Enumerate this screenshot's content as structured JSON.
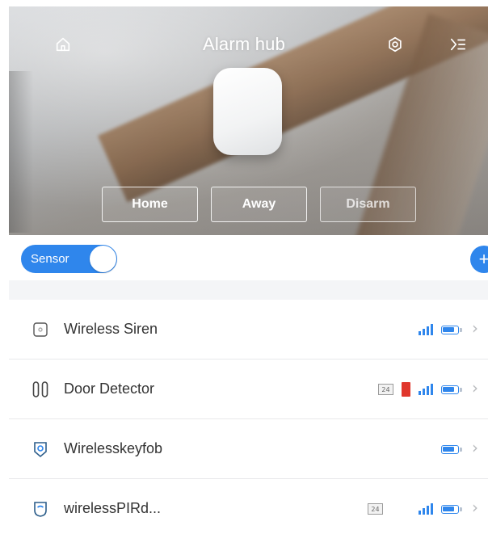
{
  "header": {
    "title": "Alarm hub",
    "home_icon": "home-icon",
    "settings_icon": "settings-icon",
    "menu_icon": "menu-icon"
  },
  "modes": [
    {
      "label": "Home",
      "dimmed": false
    },
    {
      "label": "Away",
      "dimmed": false
    },
    {
      "label": "Disarm",
      "dimmed": true
    }
  ],
  "sensor_toggle": {
    "label": "Sensor",
    "on": true
  },
  "add_button": {
    "icon": "plus-icon"
  },
  "devices": [
    {
      "name": "Wireless Siren",
      "icon": "siren-icon",
      "tag24": "",
      "door_open": false,
      "signal_bars": 4,
      "battery_level": 0.8
    },
    {
      "name": "Door Detector",
      "icon": "door-sensor-icon",
      "tag24": "24",
      "door_open": true,
      "signal_bars": 4,
      "battery_level": 0.8
    },
    {
      "name": "Wirelesskeyfob",
      "icon": "keyfob-icon",
      "tag24": "",
      "door_open": false,
      "signal_bars": 0,
      "battery_level": 0.8
    },
    {
      "name": "wirelessPIRd...",
      "icon": "pir-sensor-icon",
      "tag24": "24",
      "door_open": false,
      "signal_bars": 4,
      "battery_level": 0.8
    }
  ],
  "colors": {
    "accent": "#2f86ec",
    "alert": "#e0362c",
    "chevron": "#b9bbbe"
  }
}
